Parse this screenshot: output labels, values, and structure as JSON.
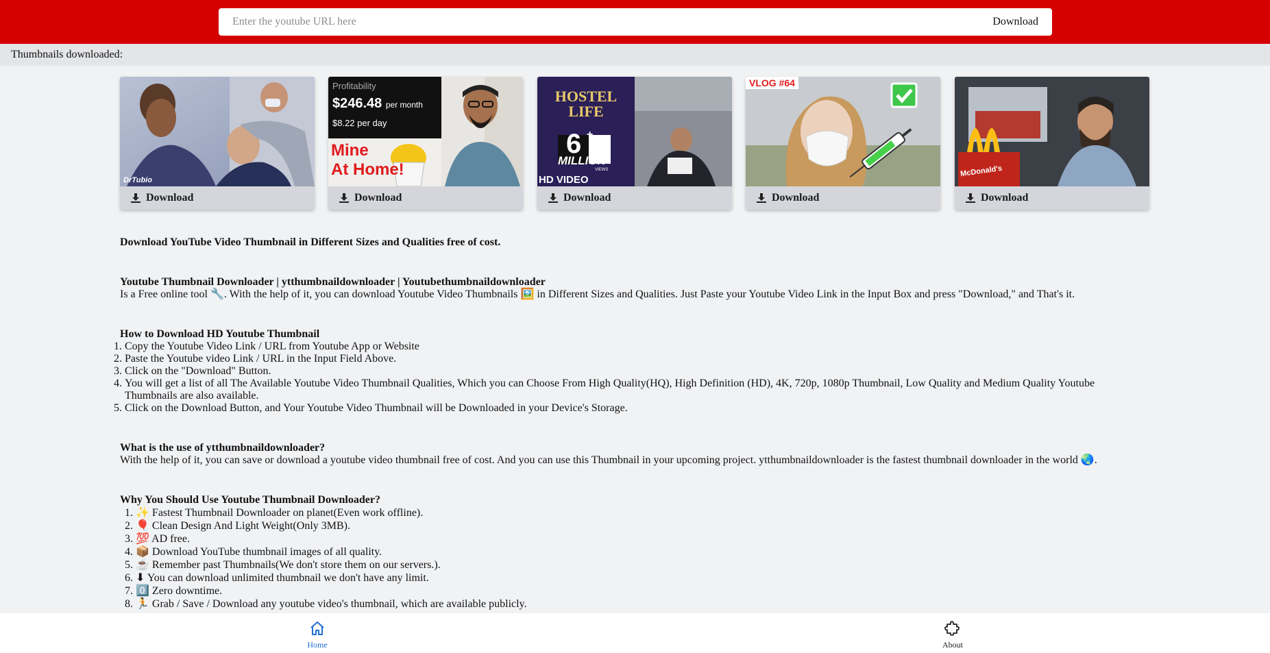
{
  "search": {
    "placeholder": "Enter the youtube URL here",
    "button_label": "Download"
  },
  "downloaded_label": "Thumbnails downloaded:",
  "thumbnails": [
    {
      "download_label": "Download",
      "caption": "DrTubio"
    },
    {
      "download_label": "Download",
      "caption_top": "Profitability",
      "price": "$246.48",
      "price_unit": "per month",
      "per_day": "$8.22 per day",
      "line1": "Mine",
      "line2": "At Home!"
    },
    {
      "download_label": "Download",
      "title1": "HOSTEL",
      "title2": "LIFE",
      "num": "6",
      "plus": "+",
      "million": "MILLION",
      "views": "VIEWS",
      "hd": "HD VIDEO"
    },
    {
      "download_label": "Download",
      "vlog": "VLOG #64"
    },
    {
      "download_label": "Download",
      "brand": "McDonald's"
    }
  ],
  "content": {
    "intro_heading": "Download YouTube Video Thumbnail in Different Sizes and Qualities free of cost.",
    "section1": {
      "heading": "Youtube Thumbnail Downloader | ytthumbnaildownloader | Youtubethumbnaildownloader",
      "text": "Is a Free online tool 🔧. With the help of it, you can download Youtube Video Thumbnails 🖼️ in Different Sizes and Qualities. Just Paste your Youtube Video Link in the Input Box and press \"Download,\" and That's it."
    },
    "section2": {
      "heading": "How to Download HD Youtube Thumbnail",
      "steps": [
        "Copy the Youtube Video Link / URL from Youtube App or Website",
        "Paste the Youtube video Link / URL in the Input Field Above.",
        "Click on the \"Download\" Button.",
        "You will get a list of all The Available Youtube Video Thumbnail Qualities, Which you can Choose From High Quality(HQ), High Definition (HD), 4K, 720p, 1080p Thumbnail, Low Quality and Medium Quality Youtube Thumbnails are also available.",
        "Click on the Download Button, and Your Youtube Video Thumbnail will be Downloaded in your Device's Storage."
      ]
    },
    "section3": {
      "heading": "What is the use of ytthumbnaildownloader?",
      "text": "With the help of it, you can save or download a youtube video thumbnail free of cost. And you can use this Thumbnail in your upcoming project. ytthumbnaildownloader is the fastest thumbnail downloader in the world 🌏."
    },
    "section4": {
      "heading": "Why You Should Use Youtube Thumbnail Downloader?",
      "points": [
        "✨ Fastest Thumbnail Downloader on planet(Even work offline).",
        "🎈 Clean Design And Light Weight(Only 3MB).",
        "💯 AD free.",
        "📦 Download YouTube thumbnail images of all quality.",
        "☕ Remember past Thumbnails(We don't store them on our servers.).",
        "⬇ You can download unlimited thumbnail we don't have any limit.",
        "0️⃣ Zero downtime.",
        "🏃 Grab / Save / Download any youtube video's thumbnail, which are available publicly."
      ]
    }
  },
  "nav": {
    "home_label": "Home",
    "about_label": "About"
  },
  "colors": {
    "header_red": "#d40000",
    "nav_active": "#1f6fd1",
    "background": "#f1f2f4"
  }
}
